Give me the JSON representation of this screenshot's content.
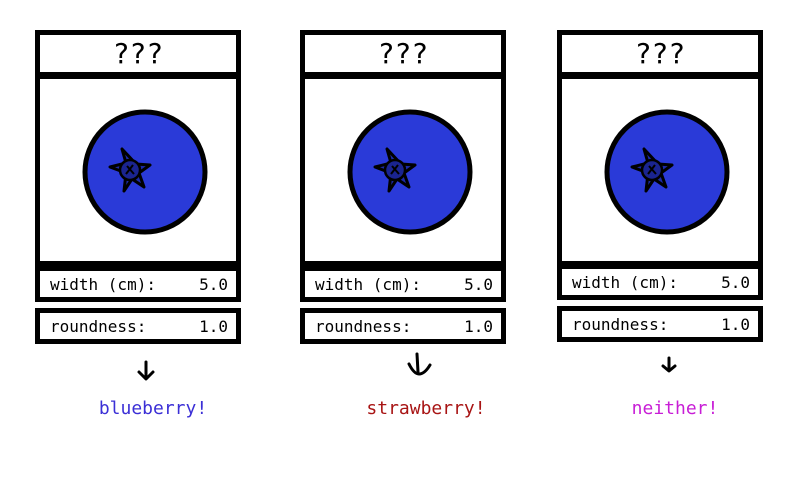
{
  "cards": [
    {
      "title": "???",
      "width_label": "width (cm):",
      "width_value": "5.0",
      "roundness_label": "roundness:",
      "roundness_value": "1.0",
      "result": "blueberry!",
      "result_color": "#3b2fd6"
    },
    {
      "title": "???",
      "width_label": "width (cm):",
      "width_value": "5.0",
      "roundness_label": "roundness:",
      "roundness_value": "1.0",
      "result": "strawberry!",
      "result_color": "#a81414"
    },
    {
      "title": "???",
      "width_label": "width (cm):",
      "width_value": "5.0",
      "roundness_label": "roundness:",
      "roundness_value": "1.0",
      "result": "neither!",
      "result_color": "#c81ed6"
    }
  ],
  "colors": {
    "berry_fill": "#2a3ad8",
    "berry_crown": "#1c2aa8",
    "outline": "#000000"
  },
  "icons": {
    "fruit": "blueberry-icon",
    "arrow": "arrow-down-icon"
  }
}
